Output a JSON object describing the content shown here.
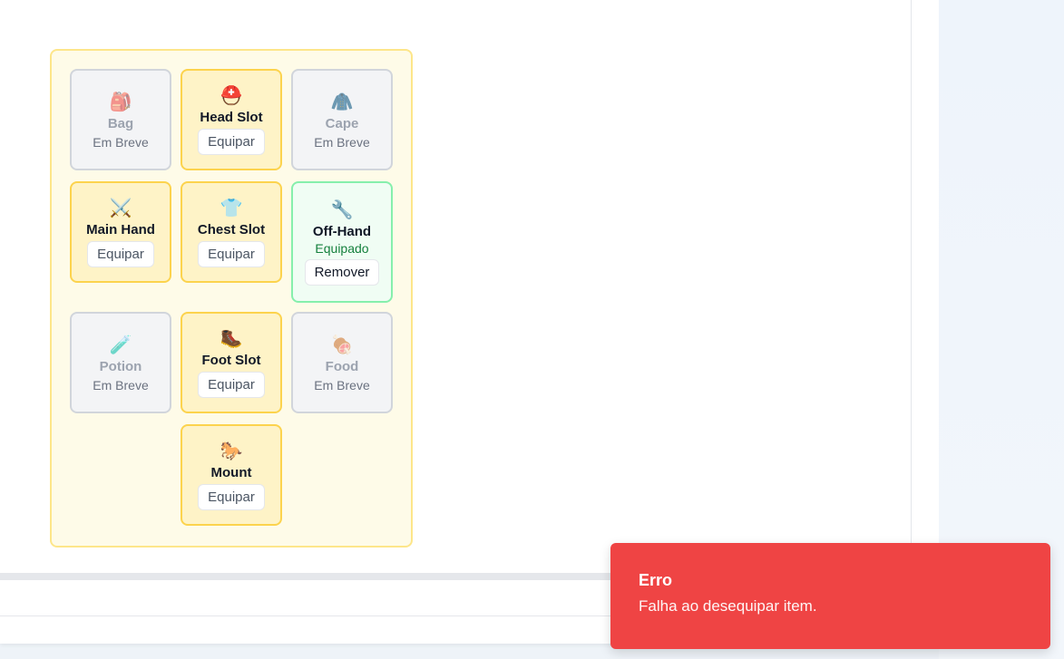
{
  "equipment": {
    "slots": [
      {
        "id": "bag",
        "icon": "🎒",
        "icon_name": "backpack-icon",
        "name": "Bag",
        "state": "disabled",
        "status": "Em Breve"
      },
      {
        "id": "head",
        "icon": "⛑️",
        "icon_name": "helmet-icon",
        "name": "Head Slot",
        "state": "active",
        "button": "Equipar"
      },
      {
        "id": "cape",
        "icon": "🧥",
        "icon_name": "coat-icon",
        "name": "Cape",
        "state": "disabled",
        "status": "Em Breve"
      },
      {
        "id": "main-hand",
        "icon": "⚔️",
        "icon_name": "crossed-swords-icon",
        "name": "Main Hand",
        "state": "active",
        "button": "Equipar"
      },
      {
        "id": "chest",
        "icon": "👕",
        "icon_name": "tshirt-icon",
        "name": "Chest Slot",
        "state": "active",
        "button": "Equipar"
      },
      {
        "id": "off-hand",
        "icon": "🔧",
        "icon_name": "wrench-icon",
        "name": "Off-Hand",
        "state": "equipped",
        "status": "Equipado",
        "button": "Remover"
      },
      {
        "id": "potion",
        "icon": "🧪",
        "icon_name": "test-tube-icon",
        "name": "Potion",
        "state": "disabled",
        "status": "Em Breve"
      },
      {
        "id": "foot",
        "icon": "🥾",
        "icon_name": "boot-icon",
        "name": "Foot Slot",
        "state": "active",
        "button": "Equipar"
      },
      {
        "id": "food",
        "icon": "🍖",
        "icon_name": "meat-icon",
        "name": "Food",
        "state": "disabled",
        "status": "Em Breve"
      },
      {
        "id": "mount",
        "icon": "🐎",
        "icon_name": "horse-icon",
        "name": "Mount",
        "state": "active",
        "button": "Equipar"
      }
    ]
  },
  "toast": {
    "title": "Erro",
    "message": "Falha ao desequipar item."
  },
  "colors": {
    "toast_bg": "#ef4444",
    "active_slot_bg": "#fef3c7",
    "equipped_slot_bg": "#f0fdf4",
    "container_bg": "#fefbe8"
  }
}
